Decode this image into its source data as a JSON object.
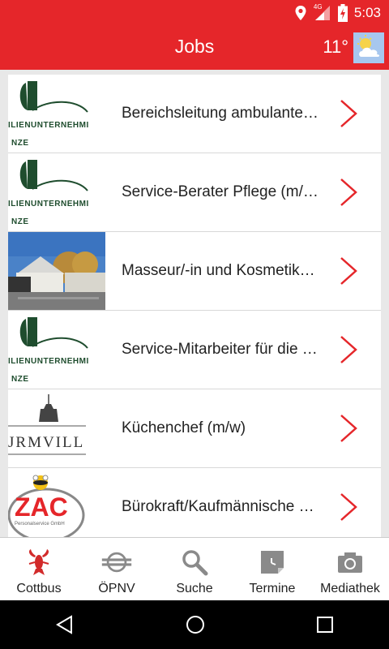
{
  "status": {
    "time": "5:03",
    "network": "4G"
  },
  "header": {
    "title": "Jobs",
    "temperature": "11°",
    "weather_icon": "partly-cloudy-icon"
  },
  "jobs": [
    {
      "label": "Bereichsleitung ambulante…",
      "thumb": "familienunternehmen-logo",
      "logo_line1": "ILIENUNTERNEHMI",
      "logo_line2": "NZE"
    },
    {
      "label": "Service-Berater Pflege (m/…",
      "thumb": "familienunternehmen-logo",
      "logo_line1": "ILIENUNTERNEHMI",
      "logo_line2": "NZE"
    },
    {
      "label": "Masseur/-in und Kosmetik…",
      "thumb": "hotel-photo"
    },
    {
      "label": "Service-Mitarbeiter für die …",
      "thumb": "familienunternehmen-logo",
      "logo_line1": "ILIENUNTERNEHMI",
      "logo_line2": "NZE"
    },
    {
      "label": "Küchenchef (m/w)",
      "thumb": "turmvilla-logo",
      "logo_line1": "JRMVILL"
    },
    {
      "label": "Bürokraft/Kaufmännische …",
      "thumb": "zac-logo",
      "logo_line1": "ZAC",
      "logo_line2": "Personalservice GmbH"
    }
  ],
  "bottom_nav": [
    {
      "label": "Cottbus",
      "icon": "crayfish-icon"
    },
    {
      "label": "ÖPNV",
      "icon": "transit-icon"
    },
    {
      "label": "Suche",
      "icon": "search-icon"
    },
    {
      "label": "Termine",
      "icon": "calendar-icon"
    },
    {
      "label": "Mediathek",
      "icon": "camera-icon"
    }
  ],
  "colors": {
    "accent": "#e5262a",
    "text": "#222222",
    "nav_icon": "#8a8a8a"
  }
}
